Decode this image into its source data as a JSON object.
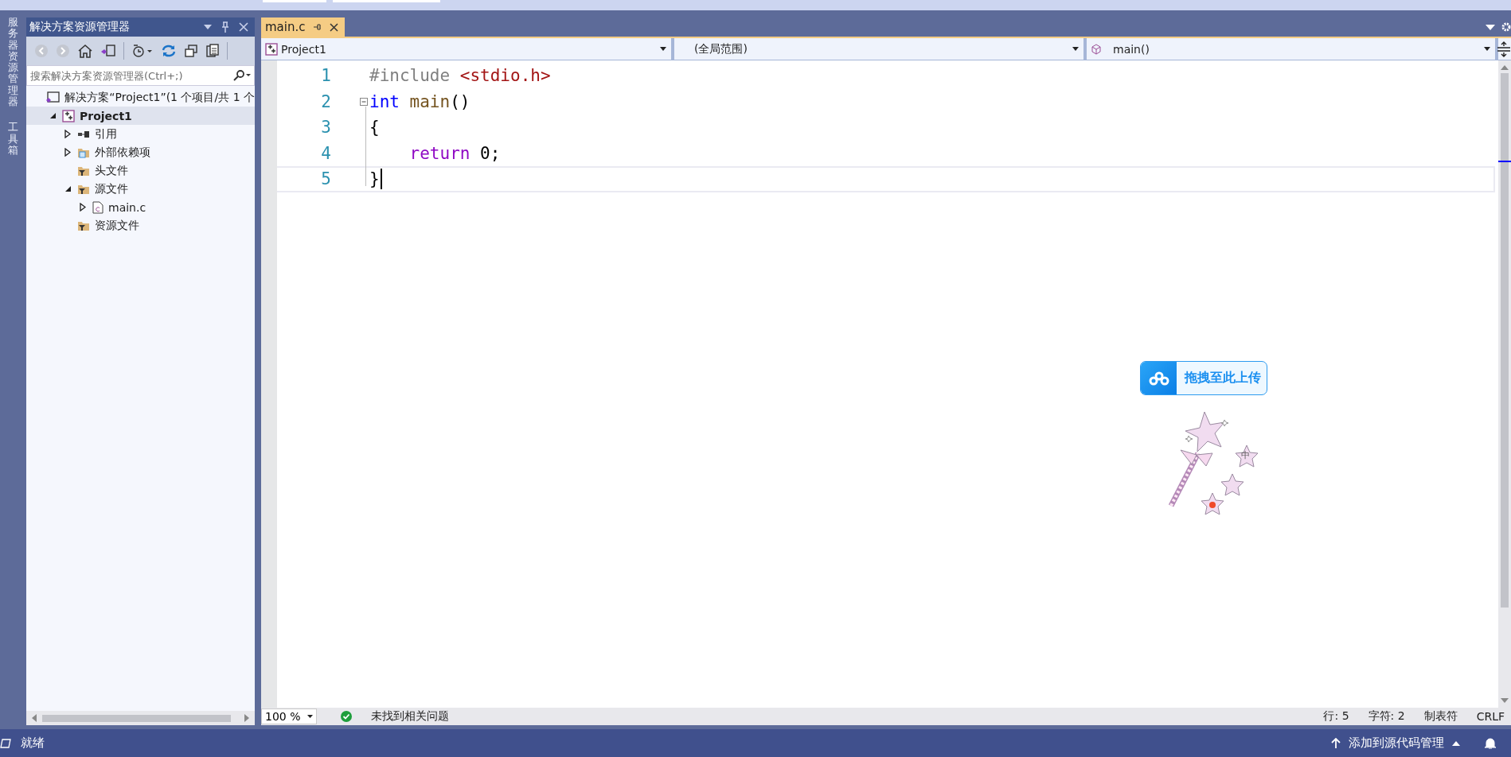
{
  "side_strip": {
    "tabs": [
      {
        "label": "服务器资源管理器",
        "selected": false
      },
      {
        "label": "工具箱",
        "selected": false
      }
    ]
  },
  "solution_explorer": {
    "title": "解决方案资源管理器",
    "search": {
      "placeholder": "搜索解决方案资源管理器(Ctrl+;)"
    },
    "tree": [
      {
        "label": "解决方案“Project1”(1 个项目/共 1 个",
        "kind": "solution",
        "selected": false,
        "children": [
          {
            "label": "Project1",
            "kind": "project",
            "expanded": true,
            "selected": true,
            "children": [
              {
                "label": "引用",
                "kind": "references",
                "expanded": false,
                "selected": false
              },
              {
                "label": "外部依赖项",
                "kind": "external",
                "expanded": false,
                "selected": false
              },
              {
                "label": "头文件",
                "kind": "filter",
                "selected": false
              },
              {
                "label": "源文件",
                "kind": "filter",
                "expanded": true,
                "selected": false,
                "children": [
                  {
                    "label": "main.c",
                    "kind": "file",
                    "expanded": false,
                    "selected": false
                  }
                ]
              },
              {
                "label": "资源文件",
                "kind": "filter",
                "selected": false
              }
            ]
          }
        ]
      }
    ]
  },
  "editor": {
    "tabs": [
      {
        "label": "main.c",
        "selected": true
      }
    ],
    "nav": {
      "project": "Project1",
      "scope": "(全局范围)",
      "member": "main()"
    },
    "lines": [
      {
        "number": "1",
        "tokens": [
          {
            "kind": "preprocessor",
            "text": "#include "
          },
          {
            "kind": "string",
            "text": "<stdio.h>"
          }
        ]
      },
      {
        "number": "2",
        "fold": true,
        "tokens": [
          {
            "kind": "keyword",
            "text": "int "
          },
          {
            "kind": "function",
            "text": "main"
          },
          {
            "kind": "plain",
            "text": "()"
          }
        ]
      },
      {
        "number": "3",
        "tokens": [
          {
            "kind": "plain",
            "text": "{"
          }
        ]
      },
      {
        "number": "4",
        "tokens": [
          {
            "kind": "control",
            "text": "    return"
          },
          {
            "kind": "plain",
            "text": " 0;"
          }
        ]
      },
      {
        "number": "5",
        "current": true,
        "tokens": [
          {
            "kind": "plain",
            "text": "}"
          }
        ]
      }
    ],
    "zoom": "100 %",
    "issues": "未找到相关问题",
    "row": "行: 5",
    "col": "字符: 2",
    "indent": "制表符",
    "eol": "CRLF"
  },
  "upload_widget": {
    "label": "拖拽至此上传"
  },
  "ime_sprite": {
    "mode": "中"
  },
  "status_bar": {
    "state": "就绪",
    "source_control": "添加到源代码管理"
  }
}
